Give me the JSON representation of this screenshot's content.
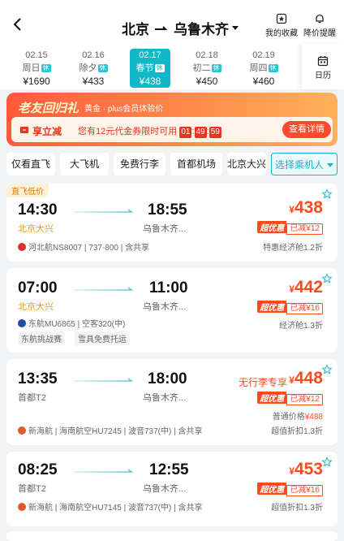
{
  "header": {
    "from": "北京",
    "to": "乌鲁木齐",
    "favorites_label": "我的收藏",
    "alert_label": "降价提醒",
    "calendar_label": "日历"
  },
  "dates": [
    {
      "date": "02.15",
      "weekday": "周日",
      "tag": "休",
      "price": "¥1690"
    },
    {
      "date": "02.16",
      "weekday": "除夕",
      "tag": "休",
      "price": "¥433"
    },
    {
      "date": "02.17",
      "weekday": "春节",
      "tag": "休",
      "price": "¥438",
      "selected": true
    },
    {
      "date": "02.18",
      "weekday": "初二",
      "tag": "休",
      "price": "¥450"
    },
    {
      "date": "02.19",
      "weekday": "周四",
      "tag": "休",
      "price": "¥460"
    }
  ],
  "promo": {
    "title": "老友回归礼",
    "subtitle": "黄金 · plus会员体验价",
    "label": "享立减",
    "text": "您有12元代金券限时可用",
    "countdown": [
      "01",
      "49",
      "59"
    ],
    "button": "查看详情"
  },
  "filters": [
    "仅看直飞",
    "大飞机",
    "免费行李",
    "首都机场",
    "北京大兴",
    "选择乘机人"
  ],
  "flights": [
    {
      "tag": "直飞低价",
      "dep_time": "14:30",
      "dep_airport": "北京大兴",
      "arr_time": "18:55",
      "arr_airport": "乌鲁木齐...",
      "currency": "¥",
      "price": "438",
      "chao": "超优惠",
      "discount": "已减¥12",
      "airline": "河北航NS8007 | 737-800 | 含共享",
      "cabin": "特惠经济舱1.2折",
      "logo_color": "#d9342b"
    },
    {
      "dep_time": "07:00",
      "dep_airport": "北京大兴",
      "arr_time": "11:00",
      "arr_airport": "乌鲁木齐...",
      "currency": "¥",
      "price": "442",
      "chao": "超优惠",
      "discount": "已减¥16",
      "airline": "东航MU6865 | 空客320(中)",
      "cabin": "经济舱1.3折",
      "pills": [
        "东航挑战赛",
        "雪具免费托运"
      ],
      "logo_color": "#1d4e9e"
    },
    {
      "dep_time": "13:35",
      "dep_airport": "首都T2",
      "arr_time": "18:00",
      "arr_airport": "乌鲁木齐...",
      "notice": "无行李专享",
      "currency": "¥",
      "price": "448",
      "chao": "超优惠",
      "discount": "已减¥12",
      "regular_label": "普通价格",
      "regular_price": "¥488",
      "airline": "新海航 | 海南航空HU7245 | 波音737(中) | 含共享",
      "cabin": "超值折扣1.3折",
      "logo_color": "#e25a2a"
    },
    {
      "dep_time": "08:25",
      "dep_airport": "首都T2",
      "arr_time": "12:55",
      "arr_airport": "乌鲁木齐...",
      "currency": "¥",
      "price": "453",
      "chao": "超优惠",
      "discount": "已减¥16",
      "airline": "新海航 | 海南航空HU7145 | 波音737(中) | 含共享",
      "cabin": "超值折扣1.3折",
      "logo_color": "#e25a2a"
    }
  ],
  "colors": {
    "accent": "#12b8c7",
    "price": "#ff4a1e",
    "highlight": "#f09a00"
  }
}
